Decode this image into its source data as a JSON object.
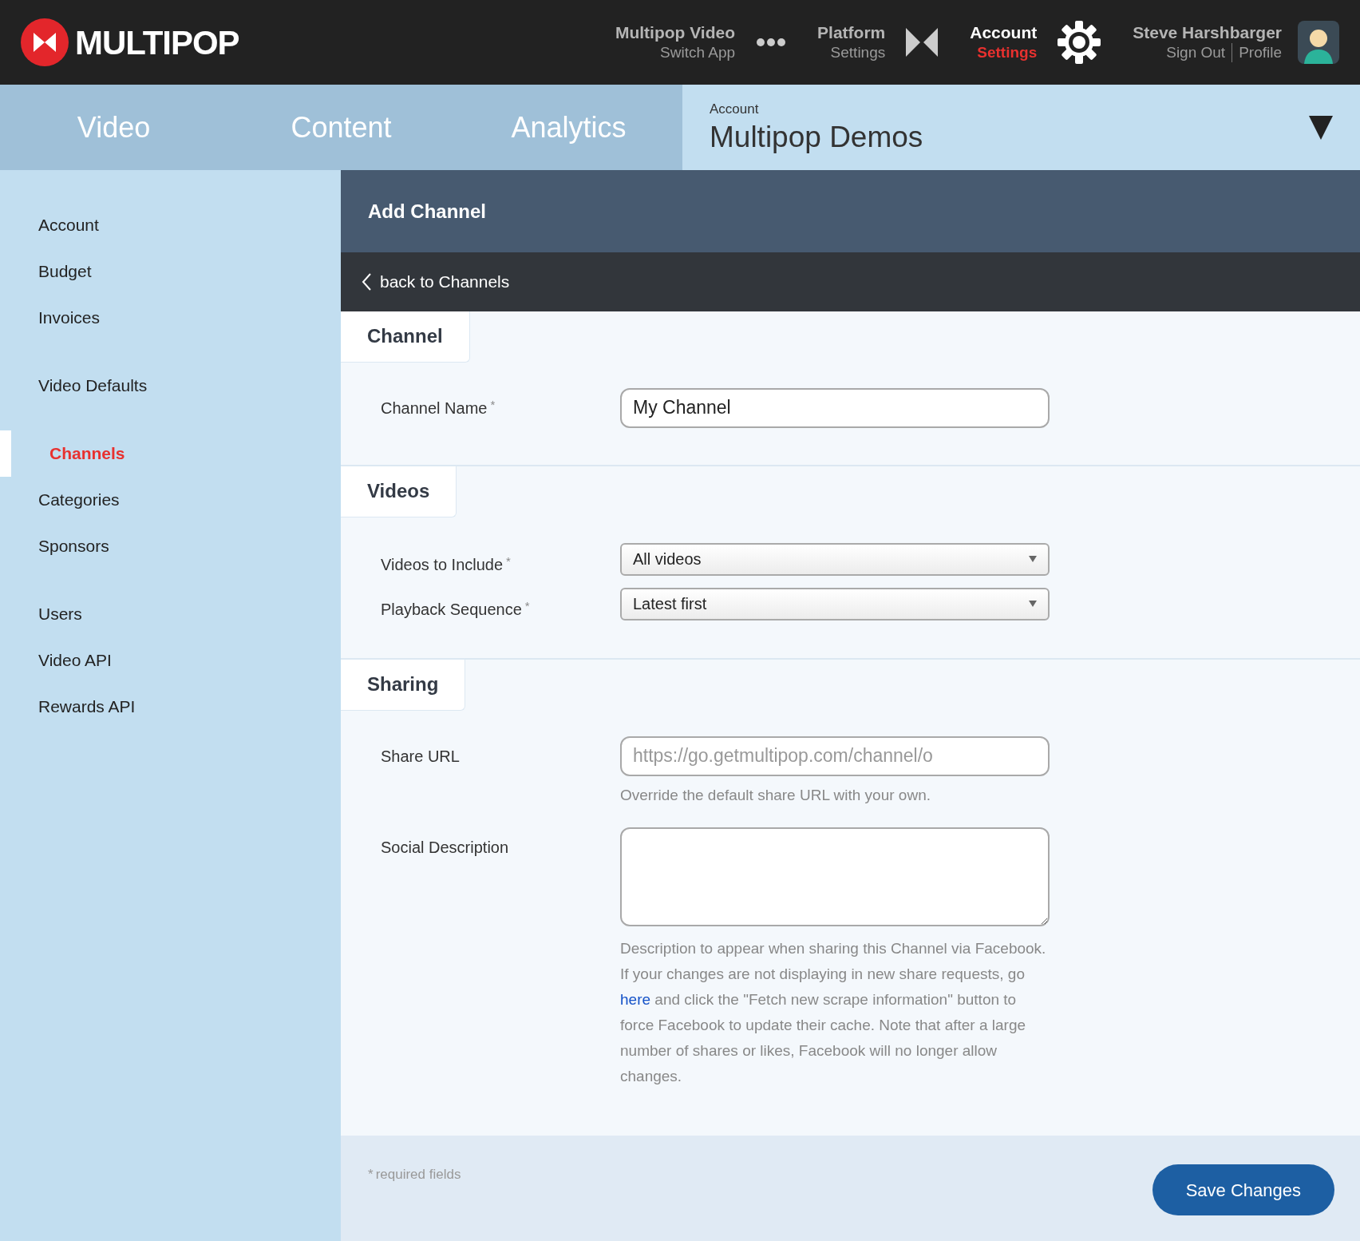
{
  "topbar": {
    "logo": "MULTIPOP",
    "nav": [
      {
        "title": "Multipop Video",
        "subtitle": "Switch App",
        "active": false
      },
      {
        "title": "Platform",
        "subtitle": "Settings",
        "active": false
      },
      {
        "title": "Account",
        "subtitle": "Settings",
        "active": true
      }
    ],
    "user": {
      "name": "Steve Harshbarger",
      "links": [
        "Sign Out",
        "Profile"
      ]
    }
  },
  "tabs": [
    {
      "label": "Video",
      "selected": false
    },
    {
      "label": "Content",
      "selected": false
    },
    {
      "label": "Analytics",
      "selected": false
    }
  ],
  "account_selector": {
    "label": "Account",
    "value": "Multipop Demos"
  },
  "sidebar": {
    "groups": [
      [
        {
          "label": "Account",
          "selected": false
        },
        {
          "label": "Budget",
          "selected": false
        },
        {
          "label": "Invoices",
          "selected": false
        }
      ],
      [
        {
          "label": "Video Defaults",
          "selected": false
        }
      ],
      [
        {
          "label": "Channels",
          "selected": true
        },
        {
          "label": "Categories",
          "selected": false
        },
        {
          "label": "Sponsors",
          "selected": false
        }
      ],
      [
        {
          "label": "Users",
          "selected": false
        },
        {
          "label": "Video API",
          "selected": false
        },
        {
          "label": "Rewards API",
          "selected": false
        }
      ]
    ]
  },
  "page_title": "Add Channel",
  "back_link": "back to Channels",
  "sections": [
    {
      "title": "Channel",
      "fields": [
        {
          "kind": "text",
          "label": "Channel Name",
          "required_mark": "*",
          "value": "My Channel"
        }
      ]
    },
    {
      "title": "Videos",
      "fields": [
        {
          "kind": "select",
          "label": "Videos to Include",
          "required_mark": "*",
          "value": "All videos"
        },
        {
          "kind": "select",
          "label": "Playback Sequence",
          "required_mark": "*",
          "value": "Latest first"
        }
      ]
    },
    {
      "title": "Sharing",
      "fields": [
        {
          "kind": "text",
          "label": "Share URL",
          "placeholder": "https://go.getmultipop.com/channel/o",
          "help": "Override the default share URL with your own."
        },
        {
          "kind": "textarea",
          "label": "Social Description",
          "help_parts": [
            "Description to appear when sharing this Channel via Facebook. If your changes are not displaying in new share requests, go ",
            "here",
            " and click the \"Fetch new scrape information\" button to force Facebook to update their cache. Note that after a large number of shares or likes, Facebook will no longer allow changes."
          ]
        }
      ]
    }
  ],
  "footer": {
    "required_mark": "*",
    "note": "required fields",
    "save_button": "Save Changes"
  }
}
